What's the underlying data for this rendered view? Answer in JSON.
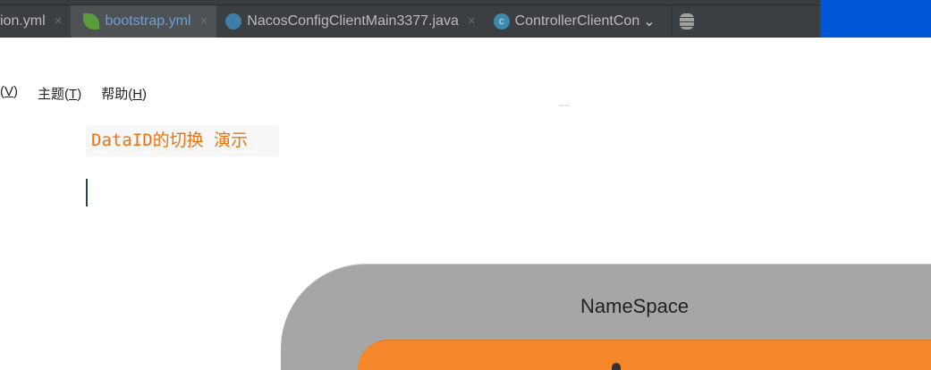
{
  "tabs": [
    {
      "label": "ion.yml",
      "icon": "yaml-icon",
      "active": false,
      "closable": true
    },
    {
      "label": "bootstrap.yml",
      "icon": "spring-leaf-icon",
      "active": true,
      "closable": true
    },
    {
      "label": "NacosConfigClientMain3377.java",
      "icon": "spring-boot-main-class-icon",
      "active": false,
      "closable": true
    },
    {
      "label": "ControllerClientCon",
      "icon": "class-icon",
      "active": false,
      "closable": false
    }
  ],
  "tab_close_glyph": "×",
  "class_icon_letter": "c",
  "menu": [
    {
      "prefix": "(",
      "key": "V",
      "suffix": ")"
    },
    {
      "prefix": "主题(",
      "key": "T",
      "suffix": ")"
    },
    {
      "prefix": "帮助(",
      "key": "H",
      "suffix": ")"
    }
  ],
  "heading": "DataID的切换 演示",
  "diagram": {
    "namespace_label": "NameSpace"
  },
  "colors": {
    "accent_heading": "#e8740f",
    "namespace": "#a6a6a6",
    "group": "#f5862a",
    "blue_panel": "#0057d6"
  }
}
